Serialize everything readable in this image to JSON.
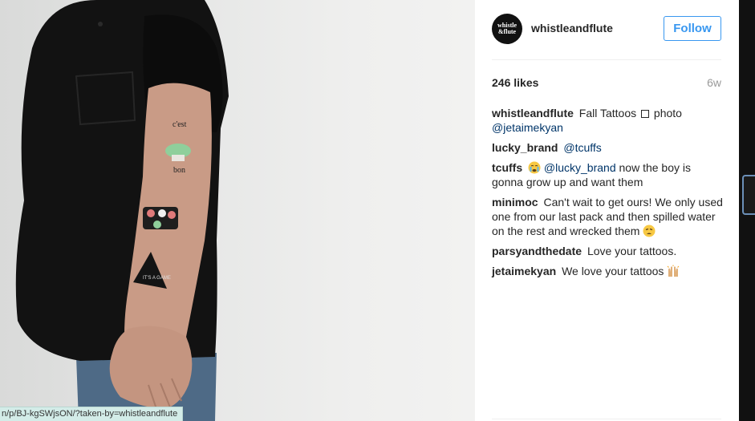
{
  "post": {
    "username": "whistleandflute",
    "avatar_text_top": "whistle",
    "avatar_text_bottom": "&flute",
    "follow_label": "Follow",
    "likes": "246 likes",
    "age": "6w"
  },
  "comments": [
    {
      "author": "whistleandflute",
      "parts": [
        "Fall Tattoos",
        "photo"
      ],
      "mention": "@jetaimekyan"
    },
    {
      "author": "lucky_brand",
      "mention": "@tcuffs"
    },
    {
      "author": "tcuffs",
      "emoji": "crying-face",
      "mention": "@lucky_brand",
      "text": "now the boy is gonna grow up and want them"
    },
    {
      "author": "minimoc",
      "text": "Can't wait to get ours! We only used one from our last pack and then spilled water on the rest and wrecked them",
      "emoji": "weary-face"
    },
    {
      "author": "parsyandthedate",
      "text": "Love your tattoos."
    },
    {
      "author": "jetaimekyan",
      "text": "We love your tattoos",
      "emoji": "raised-hands"
    }
  ],
  "photo": {
    "tattoo_text_1": "c'est",
    "tattoo_text_2": "bon",
    "tattoo_text_3": "IT'S A GAME",
    "alt": "arm-with-temporary-tattoos"
  },
  "status_bar": {
    "url": "n/p/BJ-kgSWjsON/?taken-by=whistleandflute"
  },
  "colors": {
    "follow_blue": "#3897f0",
    "mention_blue": "#003569",
    "status_bg": "#d3ece8"
  }
}
